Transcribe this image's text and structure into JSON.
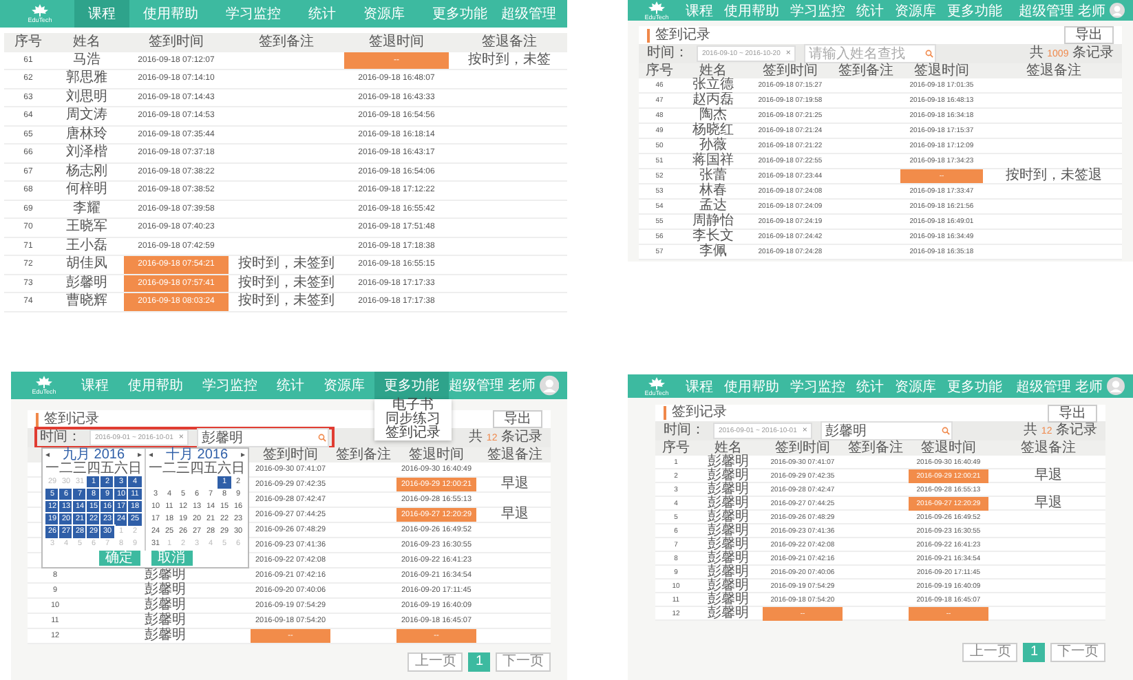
{
  "screens": [
    {
      "nav": {
        "logo": "EduTech",
        "items": [
          {
            "label": "课程",
            "selected": true
          },
          {
            "label": "使用帮助",
            "selected": false
          },
          {
            "label": "学习监控",
            "selected": false
          },
          {
            "label": "统计",
            "selected": false
          },
          {
            "label": "资源库",
            "selected": false
          },
          {
            "label": "更多功能",
            "selected": false
          }
        ],
        "user": "超级管理",
        "avatar": false
      },
      "columns": [
        "序号",
        "姓名",
        "签到时间",
        "签到备注",
        "签退时间",
        "签退备注"
      ],
      "rows": [
        {
          "no": "61",
          "name": "马浩",
          "checkin": "2016-09-18 07:12:07",
          "checkin_late": false,
          "checkout": "--",
          "checkout_late": true,
          "checkout_note": "按时到，未签"
        },
        {
          "no": "62",
          "name": "郭思雅",
          "checkin": "2016-09-18 07:14:10",
          "checkin_late": false,
          "checkout": "2016-09-18 16:48:07",
          "checkout_late": false
        },
        {
          "no": "63",
          "name": "刘思明",
          "checkin": "2016-09-18 07:14:43",
          "checkin_late": false,
          "checkout": "2016-09-18 16:43:33",
          "checkout_late": false
        },
        {
          "no": "64",
          "name": "周文涛",
          "checkin": "2016-09-18 07:14:53",
          "checkin_late": false,
          "checkout": "2016-09-18 16:54:56",
          "checkout_late": false
        },
        {
          "no": "65",
          "name": "唐林玲",
          "checkin": "2016-09-18 07:35:44",
          "checkin_late": false,
          "checkout": "2016-09-18 16:18:14",
          "checkout_late": false
        },
        {
          "no": "66",
          "name": "刘泽楷",
          "checkin": "2016-09-18 07:37:18",
          "checkin_late": false,
          "checkout": "2016-09-18 16:43:17",
          "checkout_late": false
        },
        {
          "no": "67",
          "name": "杨志刚",
          "checkin": "2016-09-18 07:38:22",
          "checkin_late": false,
          "checkout": "2016-09-18 16:54:06",
          "checkout_late": false
        },
        {
          "no": "68",
          "name": "何梓明",
          "checkin": "2016-09-18 07:38:52",
          "checkin_late": false,
          "checkout": "2016-09-18 17:12:22",
          "checkout_late": false
        },
        {
          "no": "69",
          "name": "李耀",
          "checkin": "2016-09-18 07:39:58",
          "checkin_late": false,
          "checkout": "2016-09-18 16:55:42",
          "checkout_late": false
        },
        {
          "no": "70",
          "name": "王晓军",
          "checkin": "2016-09-18 07:40:23",
          "checkin_late": false,
          "checkout": "2016-09-18 17:51:48",
          "checkout_late": false
        },
        {
          "no": "71",
          "name": "王小磊",
          "checkin": "2016-09-18 07:42:59",
          "checkin_late": false,
          "checkout": "2016-09-18 17:18:38",
          "checkout_late": false
        },
        {
          "no": "72",
          "name": "胡佳凤",
          "checkin": "2016-09-18 07:54:21",
          "checkin_late": true,
          "checkin_note": "按时到，未签到",
          "checkout": "2016-09-18 16:55:15",
          "checkout_late": false
        },
        {
          "no": "73",
          "name": "彭馨明",
          "checkin": "2016-09-18 07:57:41",
          "checkin_late": true,
          "checkin_note": "按时到，未签到",
          "checkout": "2016-09-18 17:17:33",
          "checkout_late": false
        },
        {
          "no": "74",
          "name": "曹晓辉",
          "checkin": "2016-09-18 08:03:24",
          "checkin_late": true,
          "checkin_note": "按时到，未签到",
          "checkout": "2016-09-18 17:17:38",
          "checkout_late": false
        }
      ]
    },
    {
      "nav": {
        "logo": "EduTech",
        "items": [
          {
            "label": "课程",
            "selected": false
          },
          {
            "label": "使用帮助",
            "selected": false
          },
          {
            "label": "学习监控",
            "selected": false
          },
          {
            "label": "统计",
            "selected": false
          },
          {
            "label": "资源库",
            "selected": false
          },
          {
            "label": "更多功能",
            "selected": false
          }
        ],
        "user": "超级管理 老师",
        "avatar": true
      },
      "header": {
        "title": "签到记录",
        "export": "导出"
      },
      "filter": {
        "label": "时间：",
        "range": "2016-09-10 ~ 2016-10-20",
        "clear": "×",
        "search_placeholder": "请输入姓名查找",
        "count_prefix": "共",
        "count": "1009",
        "count_suffix": "条记录",
        "highlighted": false
      },
      "columns": [
        "序号",
        "姓名",
        "签到时间",
        "签到备注",
        "签退时间",
        "签退备注"
      ],
      "rows": [
        {
          "no": "46",
          "name": "张立德",
          "checkin": "2016-09-18 07:15:27",
          "checkin_late": false,
          "checkout": "2016-09-18 17:01:35",
          "checkout_late": false
        },
        {
          "no": "47",
          "name": "赵丙磊",
          "checkin": "2016-09-18 07:19:58",
          "checkin_late": false,
          "checkout": "2016-09-18 16:48:13",
          "checkout_late": false
        },
        {
          "no": "48",
          "name": "陶杰",
          "checkin": "2016-09-18 07:21:25",
          "checkin_late": false,
          "checkout": "2016-09-18 16:34:18",
          "checkout_late": false
        },
        {
          "no": "49",
          "name": "杨晓红",
          "checkin": "2016-09-18 07:21:24",
          "checkin_late": false,
          "checkout": "2016-09-18 17:15:37",
          "checkout_late": false
        },
        {
          "no": "50",
          "name": "孙薇",
          "checkin": "2016-09-18 07:21:22",
          "checkin_late": false,
          "checkout": "2016-09-18 17:12:09",
          "checkout_late": false
        },
        {
          "no": "51",
          "name": "蒋国祥",
          "checkin": "2016-09-18 07:22:55",
          "checkin_late": false,
          "checkout": "2016-09-18 17:34:23",
          "checkout_late": false
        },
        {
          "no": "52",
          "name": "张蕾",
          "checkin": "2016-09-18 07:23:44",
          "checkin_late": false,
          "checkout": "--",
          "checkout_late": true,
          "checkout_note": "按时到，未签退"
        },
        {
          "no": "53",
          "name": "林春",
          "checkin": "2016-09-18 07:24:08",
          "checkin_late": false,
          "checkout": "2016-09-18 17:33:47",
          "checkout_late": false
        },
        {
          "no": "54",
          "name": "孟达",
          "checkin": "2016-09-18 07:24:09",
          "checkin_late": false,
          "checkout": "2016-09-18 16:21:56",
          "checkout_late": false
        },
        {
          "no": "55",
          "name": "周静怡",
          "checkin": "2016-09-18 07:24:19",
          "checkin_late": false,
          "checkout": "2016-09-18 16:49:01",
          "checkout_late": false
        },
        {
          "no": "56",
          "name": "李长文",
          "checkin": "2016-09-18 07:24:42",
          "checkin_late": false,
          "checkout": "2016-09-18 16:34:49",
          "checkout_late": false
        },
        {
          "no": "57",
          "name": "李佩",
          "checkin": "2016-09-18 07:24:28",
          "checkin_late": false,
          "checkout": "2016-09-18 16:35:18",
          "checkout_late": false
        }
      ]
    },
    {
      "nav": {
        "logo": "EduTech",
        "items": [
          {
            "label": "课程",
            "selected": false
          },
          {
            "label": "使用帮助",
            "selected": false
          },
          {
            "label": "学习监控",
            "selected": false
          },
          {
            "label": "统计",
            "selected": false
          },
          {
            "label": "资源库",
            "selected": false
          },
          {
            "label": "更多功能",
            "selected": true
          }
        ],
        "user": "超级管理 老师",
        "avatar": true
      },
      "dropdown": [
        "电子书",
        "同步练习",
        "签到记录"
      ],
      "header": {
        "title": "签到记录",
        "export": "导出"
      },
      "filter": {
        "label": "时间：",
        "range": "2016-09-01 ~ 2016-10-01",
        "clear": "×",
        "search_value": "彭馨明",
        "count_prefix": "共",
        "count": "12",
        "count_suffix": "条记录",
        "highlighted": true
      },
      "calendar": {
        "months": [
          {
            "prev": "◂",
            "title": "九月 2016",
            "next": "▸",
            "weekdays": [
              "一",
              "二",
              "三",
              "四",
              "五",
              "六",
              "日"
            ],
            "weeks": [
              [
                {
                  "d": "29",
                  "kind": "other",
                  "selected": false
                },
                {
                  "d": "30",
                  "kind": "other",
                  "selected": false
                },
                {
                  "d": "31",
                  "kind": "other",
                  "selected": false
                },
                {
                  "d": "1",
                  "kind": "day",
                  "selected": true
                },
                {
                  "d": "2",
                  "kind": "day",
                  "selected": true
                },
                {
                  "d": "3",
                  "kind": "day",
                  "selected": true
                },
                {
                  "d": "4",
                  "kind": "day",
                  "selected": true
                }
              ],
              [
                {
                  "d": "5",
                  "kind": "day",
                  "selected": true
                },
                {
                  "d": "6",
                  "kind": "day",
                  "selected": true
                },
                {
                  "d": "7",
                  "kind": "day",
                  "selected": true
                },
                {
                  "d": "8",
                  "kind": "day",
                  "selected": true
                },
                {
                  "d": "9",
                  "kind": "day",
                  "selected": true
                },
                {
                  "d": "10",
                  "kind": "day",
                  "selected": true
                },
                {
                  "d": "11",
                  "kind": "day",
                  "selected": true
                }
              ],
              [
                {
                  "d": "12",
                  "kind": "day",
                  "selected": true
                },
                {
                  "d": "13",
                  "kind": "day",
                  "selected": true
                },
                {
                  "d": "14",
                  "kind": "day",
                  "selected": true
                },
                {
                  "d": "15",
                  "kind": "day",
                  "selected": true
                },
                {
                  "d": "16",
                  "kind": "day",
                  "selected": true
                },
                {
                  "d": "17",
                  "kind": "day",
                  "selected": true
                },
                {
                  "d": "18",
                  "kind": "day",
                  "selected": true
                }
              ],
              [
                {
                  "d": "19",
                  "kind": "day",
                  "selected": true
                },
                {
                  "d": "20",
                  "kind": "day",
                  "selected": true
                },
                {
                  "d": "21",
                  "kind": "day",
                  "selected": true
                },
                {
                  "d": "22",
                  "kind": "day",
                  "selected": true
                },
                {
                  "d": "23",
                  "kind": "day",
                  "selected": true
                },
                {
                  "d": "24",
                  "kind": "day",
                  "selected": true
                },
                {
                  "d": "25",
                  "kind": "day",
                  "selected": true
                }
              ],
              [
                {
                  "d": "26",
                  "kind": "day",
                  "selected": true
                },
                {
                  "d": "27",
                  "kind": "day",
                  "selected": true
                },
                {
                  "d": "28",
                  "kind": "day",
                  "selected": true
                },
                {
                  "d": "29",
                  "kind": "day",
                  "selected": true
                },
                {
                  "d": "30",
                  "kind": "day",
                  "selected": true
                },
                {
                  "d": "1",
                  "kind": "other",
                  "selected": false
                },
                {
                  "d": "2",
                  "kind": "other",
                  "selected": false
                }
              ],
              [
                {
                  "d": "3",
                  "kind": "other",
                  "selected": false
                },
                {
                  "d": "4",
                  "kind": "other",
                  "selected": false
                },
                {
                  "d": "5",
                  "kind": "other",
                  "selected": false
                },
                {
                  "d": "6",
                  "kind": "other",
                  "selected": false
                },
                {
                  "d": "7",
                  "kind": "other",
                  "selected": false
                },
                {
                  "d": "8",
                  "kind": "other",
                  "selected": false
                },
                {
                  "d": "9",
                  "kind": "other",
                  "selected": false
                }
              ]
            ]
          },
          {
            "prev": "◂",
            "title": "十月 2016",
            "next": "▸",
            "weekdays": [
              "一",
              "二",
              "三",
              "四",
              "五",
              "六",
              "日"
            ],
            "weeks": [
              [
                {
                  "kind": "blank"
                },
                {
                  "kind": "blank"
                },
                {
                  "kind": "blank"
                },
                {
                  "kind": "blank"
                },
                {
                  "kind": "blank"
                },
                {
                  "d": "1",
                  "kind": "day",
                  "selected": true
                },
                {
                  "d": "2",
                  "kind": "day",
                  "selected": false
                }
              ],
              [
                {
                  "d": "3",
                  "kind": "day",
                  "selected": false
                },
                {
                  "d": "4",
                  "kind": "day",
                  "selected": false
                },
                {
                  "d": "5",
                  "kind": "day",
                  "selected": false
                },
                {
                  "d": "6",
                  "kind": "day",
                  "selected": false
                },
                {
                  "d": "7",
                  "kind": "day",
                  "selected": false
                },
                {
                  "d": "8",
                  "kind": "day",
                  "selected": false
                },
                {
                  "d": "9",
                  "kind": "day",
                  "selected": false
                }
              ],
              [
                {
                  "d": "10",
                  "kind": "day",
                  "selected": false
                },
                {
                  "d": "11",
                  "kind": "day",
                  "selected": false
                },
                {
                  "d": "12",
                  "kind": "day",
                  "selected": false
                },
                {
                  "d": "13",
                  "kind": "day",
                  "selected": false
                },
                {
                  "d": "14",
                  "kind": "day",
                  "selected": false
                },
                {
                  "d": "15",
                  "kind": "day",
                  "selected": false
                },
                {
                  "d": "16",
                  "kind": "day",
                  "selected": false
                }
              ],
              [
                {
                  "d": "17",
                  "kind": "day",
                  "selected": false
                },
                {
                  "d": "18",
                  "kind": "day",
                  "selected": false
                },
                {
                  "d": "19",
                  "kind": "day",
                  "selected": false
                },
                {
                  "d": "20",
                  "kind": "day",
                  "selected": false
                },
                {
                  "d": "21",
                  "kind": "day",
                  "selected": false
                },
                {
                  "d": "22",
                  "kind": "day",
                  "selected": false
                },
                {
                  "d": "23",
                  "kind": "day",
                  "selected": false
                }
              ],
              [
                {
                  "d": "24",
                  "kind": "day",
                  "selected": false
                },
                {
                  "d": "25",
                  "kind": "day",
                  "selected": false
                },
                {
                  "d": "26",
                  "kind": "day",
                  "selected": false
                },
                {
                  "d": "27",
                  "kind": "day",
                  "selected": false
                },
                {
                  "d": "28",
                  "kind": "day",
                  "selected": false
                },
                {
                  "d": "29",
                  "kind": "day",
                  "selected": false
                },
                {
                  "d": "30",
                  "kind": "day",
                  "selected": false
                }
              ],
              [
                {
                  "d": "31",
                  "kind": "day",
                  "selected": false
                },
                {
                  "d": "1",
                  "kind": "other",
                  "selected": false
                },
                {
                  "d": "2",
                  "kind": "other",
                  "selected": false
                },
                {
                  "d": "3",
                  "kind": "other",
                  "selected": false
                },
                {
                  "d": "4",
                  "kind": "other",
                  "selected": false
                },
                {
                  "d": "5",
                  "kind": "other",
                  "selected": false
                },
                {
                  "d": "6",
                  "kind": "other",
                  "selected": false
                }
              ]
            ]
          }
        ],
        "confirm": "确定",
        "cancel": "取消"
      },
      "columns": [
        null,
        null,
        "签到时间",
        "签到备注",
        "签退时间",
        "签退备注"
      ],
      "rows": [
        {
          "checkin": "2016-09-30 07:41:07",
          "checkin_late": false,
          "checkout": "2016-09-30 16:40:49",
          "checkout_late": false
        },
        {
          "checkin": "2016-09-29 07:42:35",
          "checkin_late": false,
          "checkout": "2016-09-29 12:00:21",
          "checkout_late": true,
          "checkout_note": "早退"
        },
        {
          "checkin": "2016-09-28 07:42:47",
          "checkin_late": false,
          "checkout": "2016-09-28 16:55:13",
          "checkout_late": false
        },
        {
          "checkin": "2016-09-27 07:44:25",
          "checkin_late": false,
          "checkout": "2016-09-27 12:20:29",
          "checkout_late": true,
          "checkout_note": "早退"
        },
        {
          "checkin": "2016-09-26 07:48:29",
          "checkin_late": false,
          "checkout": "2016-09-26 16:49:52",
          "checkout_late": false
        },
        {
          "checkin": "2016-09-23 07:41:36",
          "checkin_late": false,
          "checkout": "2016-09-23 16:30:55",
          "checkout_late": false
        },
        {
          "checkin": "2016-09-22 07:42:08",
          "checkin_late": false,
          "checkout": "2016-09-22 16:41:23",
          "checkout_late": false
        },
        {
          "no": "8",
          "name": "彭馨明",
          "checkin": "2016-09-21 07:42:16",
          "checkin_late": false,
          "checkout": "2016-09-21 16:34:54",
          "checkout_late": false
        },
        {
          "no": "9",
          "name": "彭馨明",
          "checkin": "2016-09-20 07:40:06",
          "checkin_late": false,
          "checkout": "2016-09-20 17:11:45",
          "checkout_late": false
        },
        {
          "no": "10",
          "name": "彭馨明",
          "checkin": "2016-09-19 07:54:29",
          "checkin_late": false,
          "checkout": "2016-09-19 16:40:09",
          "checkout_late": false
        },
        {
          "no": "11",
          "name": "彭馨明",
          "checkin": "2016-09-18 07:54:20",
          "checkin_late": false,
          "checkout": "2016-09-18 16:45:07",
          "checkout_late": false
        },
        {
          "no": "12",
          "name": "彭馨明",
          "checkin": "--",
          "checkin_late": true,
          "checkout": "--",
          "checkout_late": true
        }
      ],
      "pagination": {
        "prev": "上一页",
        "pages": [
          {
            "label": "1",
            "selected": true
          }
        ],
        "next": "下一页"
      }
    },
    {
      "nav": {
        "logo": "EduTech",
        "items": [
          {
            "label": "课程",
            "selected": false
          },
          {
            "label": "使用帮助",
            "selected": false
          },
          {
            "label": "学习监控",
            "selected": false
          },
          {
            "label": "统计",
            "selected": false
          },
          {
            "label": "资源库",
            "selected": false
          },
          {
            "label": "更多功能",
            "selected": false
          }
        ],
        "user": "超级管理 老师",
        "avatar": true
      },
      "header": {
        "title": "签到记录",
        "export": "导出"
      },
      "filter": {
        "label": "时间：",
        "range": "2016-09-01 ~ 2016-10-01",
        "clear": "×",
        "search_value": "彭馨明",
        "count_prefix": "共",
        "count": "12",
        "count_suffix": "条记录",
        "highlighted": false
      },
      "columns": [
        "序号",
        "姓名",
        "签到时间",
        "签到备注",
        "签退时间",
        "签退备注"
      ],
      "rows": [
        {
          "no": "1",
          "name": "彭馨明",
          "checkin": "2016-09-30 07:41:07",
          "checkin_late": false,
          "checkout": "2016-09-30 16:40:49",
          "checkout_late": false
        },
        {
          "no": "2",
          "name": "彭馨明",
          "checkin": "2016-09-29 07:42:35",
          "checkin_late": false,
          "checkout": "2016-09-29 12:00:21",
          "checkout_late": true,
          "checkout_note": "早退"
        },
        {
          "no": "3",
          "name": "彭馨明",
          "checkin": "2016-09-28 07:42:47",
          "checkin_late": false,
          "checkout": "2016-09-28 16:55:13",
          "checkout_late": false
        },
        {
          "no": "4",
          "name": "彭馨明",
          "checkin": "2016-09-27 07:44:25",
          "checkin_late": false,
          "checkout": "2016-09-27 12:20:29",
          "checkout_late": true,
          "checkout_note": "早退"
        },
        {
          "no": "5",
          "name": "彭馨明",
          "checkin": "2016-09-26 07:48:29",
          "checkin_late": false,
          "checkout": "2016-09-26 16:49:52",
          "checkout_late": false
        },
        {
          "no": "6",
          "name": "彭馨明",
          "checkin": "2016-09-23 07:41:36",
          "checkin_late": false,
          "checkout": "2016-09-23 16:30:55",
          "checkout_late": false
        },
        {
          "no": "7",
          "name": "彭馨明",
          "checkin": "2016-09-22 07:42:08",
          "checkin_late": false,
          "checkout": "2016-09-22 16:41:23",
          "checkout_late": false
        },
        {
          "no": "8",
          "name": "彭馨明",
          "checkin": "2016-09-21 07:42:16",
          "checkin_late": false,
          "checkout": "2016-09-21 16:34:54",
          "checkout_late": false
        },
        {
          "no": "9",
          "name": "彭馨明",
          "checkin": "2016-09-20 07:40:06",
          "checkin_late": false,
          "checkout": "2016-09-20 17:11:45",
          "checkout_late": false
        },
        {
          "no": "10",
          "name": "彭馨明",
          "checkin": "2016-09-19 07:54:29",
          "checkin_late": false,
          "checkout": "2016-09-19 16:40:09",
          "checkout_late": false
        },
        {
          "no": "11",
          "name": "彭馨明",
          "checkin": "2016-09-18 07:54:20",
          "checkin_late": false,
          "checkout": "2016-09-18 16:45:07",
          "checkout_late": false
        },
        {
          "no": "12",
          "name": "彭馨明",
          "checkin": "--",
          "checkin_late": true,
          "checkout": "--",
          "checkout_late": true
        }
      ],
      "pagination": {
        "prev": "上一页",
        "pages": [
          {
            "label": "1",
            "selected": true
          }
        ],
        "next": "下一页"
      }
    }
  ]
}
